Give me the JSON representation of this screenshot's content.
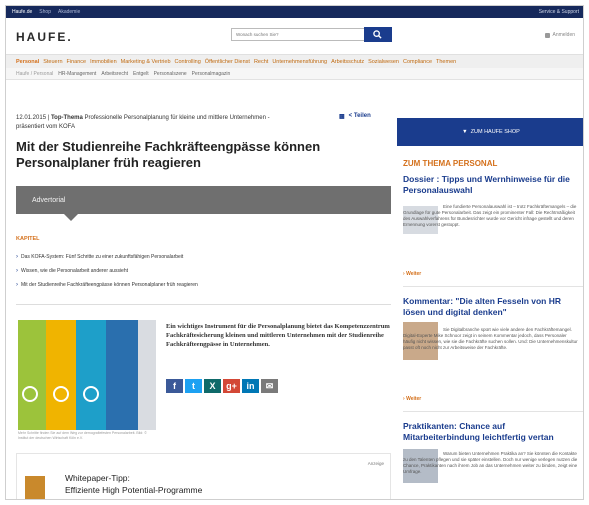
{
  "topbar": {
    "links": [
      "Haufe.de",
      "Shop",
      "Akademie"
    ],
    "right": "Service & Support"
  },
  "header": {
    "logo": "HAUFE.",
    "search_placeholder": "Wonach suchen Sie?",
    "login": "Anmelden"
  },
  "nav": {
    "items": [
      "Personal",
      "Steuern",
      "Finance",
      "Immobilien",
      "Marketing & Vertrieb",
      "Controlling",
      "Öffentlicher Dienst",
      "Recht",
      "Unternehmensführung",
      "Arbeitsschutz",
      "Sozialwesen",
      "Compliance",
      "Themen"
    ]
  },
  "subnav": {
    "breadcrumb": "Haufe / Personal",
    "items": [
      "HR-Management",
      "Arbeitsrecht",
      "Entgelt",
      "Personalszene",
      "Personalmagazin"
    ]
  },
  "article": {
    "date": "12.01.2015",
    "kicker": "Top-Thema",
    "meta_line1": "Professionelle Personalplanung für kleine und mittlere Unternehmen -",
    "meta_line2": "präsentiert vom KOFA",
    "share_label": "Teilen",
    "title": "Mit der Studienreihe Fachkräfteengpässe können Personalplaner früh reagieren",
    "advertorial": "Advertorial",
    "kapitel": "KAPITEL",
    "chapters": [
      "Das KOFA-System: Fünf Schritte zu einer zukunftsfähigen Personalarbeit",
      "Wissen, wie die Personalarbeit anderer aussieht",
      "Mit der Studienreihe Fachkräfteengpässe können Personalplaner früh reagieren"
    ],
    "promo_text": "Ein wichtiges Instrument für die Personalplanung bietet das Kompetenzzentrum Fachkräftesicherung kleinen und mittleren Unternehmen mit der Studienreihe Fachkräfteengpässe in Unternehmen.",
    "promo_caption": "Mehr Schritte finden Sie auf dem Weg zur demografiefesten Personalarbeit. Bild: © Institut der deutschen Wirtschaft Köln e.V."
  },
  "ad": {
    "label": "Anzeige",
    "title_line1": "Whitepaper-Tipp:",
    "title_line2": "Effiziente High Potential-Programme"
  },
  "sidebar": {
    "shop_label": "ZUM HAUFE SHOP",
    "section_head": "ZUM THEMA PERSONAL",
    "weiter": "Weiter",
    "teasers": [
      {
        "title": "Dossier : Tipps und Wernhinweise für die Personalauswahl",
        "text": "Eine fundierte Personalauswahl ist – trotz Fachkräftemangels – die Grundlage für gute Personalarbeit. Das zeigt ein prominenter Fall: Die Rechtmäßigkeit des Auswahlverfahrens für Bundesrichter wurde vor Gericht infrage gestellt und deren Ernennung vorerst gestoppt."
      },
      {
        "title": "Kommentar: \"Die alten Fesseln von HR lösen und digital denken\"",
        "text": "Sie Digitalbranche spürt wie viele andere den Fachkräftemangel. Digital-Experte Mike Schnoor zeigt in seinem Kommentar jedoch, dass Personaler häufig nicht wissen, wie sie die Fachkräfte suchen sollen. Und: Die Unternehmenskultur passt oft noch nicht zur Arbeitsweise der Fachkräfte."
      },
      {
        "title": "Praktikanten: Chance auf Mitarbeiterbindung leichtfertig vertan",
        "text": "Warum bieten Unternehmen Praktika an? Sie könnten die Kontakte zu den Talenten pflegen und sie später einstellen. Doch nur wenige verlegen nutzen die Chance, Praktikanten nach ihrem Job an das Unternehmen weiter zu binden, zeigt eine Umfrage."
      }
    ]
  },
  "colors": {
    "brand_blue": "#1a3c8d",
    "accent_orange": "#d4701b",
    "advertorial_gray": "#6f6f6f",
    "topbar_navy": "#16295c"
  }
}
